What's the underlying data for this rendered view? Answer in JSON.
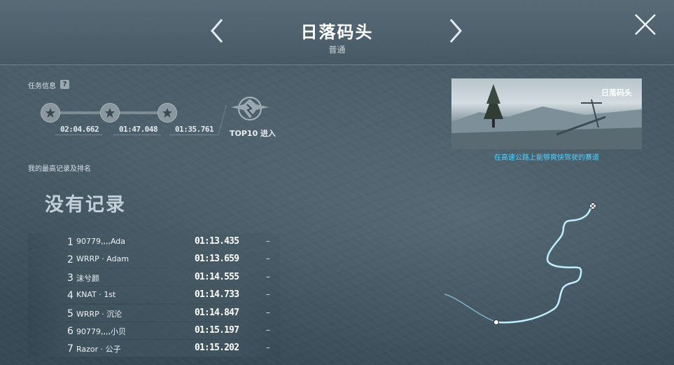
{
  "header": {
    "title": "日落码头",
    "subtitle": "普通"
  },
  "mission": {
    "info_label": "任务信息",
    "help_glyph": "?",
    "medal_times": [
      "02:04.662",
      "01:47.048",
      "01:35.761"
    ],
    "top10_label": "TOP10 进入"
  },
  "my_record": {
    "label": "我的最高记录及排名",
    "empty_text": "没有记录"
  },
  "leaderboard": [
    {
      "rank": "1",
      "name": "90779,,,,Ada",
      "time": "01:13.435",
      "extra": "–"
    },
    {
      "rank": "2",
      "name": "WRRP · Adam",
      "time": "01:13.659",
      "extra": "–"
    },
    {
      "rank": "3",
      "name": "沫兮颜",
      "time": "01:14.555",
      "extra": "–"
    },
    {
      "rank": "4",
      "name": "KNAT · 1st",
      "time": "01:14.733",
      "extra": "–"
    },
    {
      "rank": "5",
      "name": "WRRP · 沉沦",
      "time": "01:14.847",
      "extra": "–"
    },
    {
      "rank": "6",
      "name": "90779,,,,小贝",
      "time": "01:15.197",
      "extra": "–"
    },
    {
      "rank": "7",
      "name": "Razor · 公子",
      "time": "01:15.202",
      "extra": "–"
    }
  ],
  "preview": {
    "title": "日落码头",
    "caption": "在高速公路上能够爽快驾驶的赛道"
  },
  "colors": {
    "accent": "#4fd2ff",
    "track": "#a9e6ff"
  }
}
